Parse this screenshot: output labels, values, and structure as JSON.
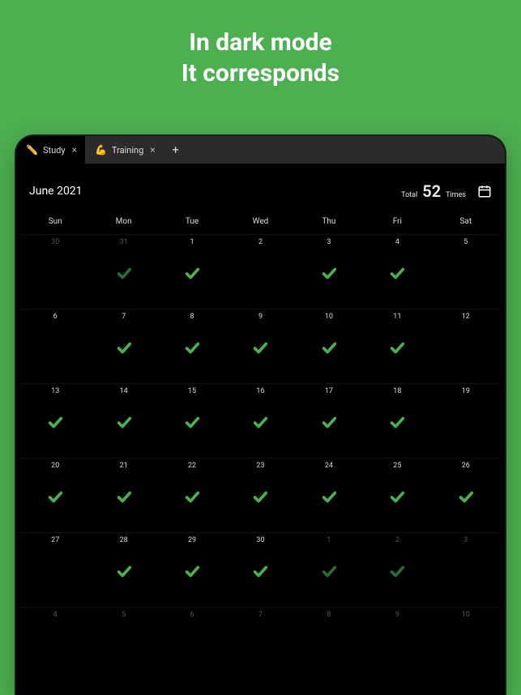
{
  "promo": {
    "line1": "In dark mode",
    "line2": "It corresponds"
  },
  "tabs": [
    {
      "emoji": "✏️",
      "label": "Study",
      "active": true
    },
    {
      "emoji": "💪",
      "label": "Training",
      "active": false
    }
  ],
  "header": {
    "month": "June 2021",
    "total_label": "Total",
    "total_value": "52",
    "total_unit": "Times"
  },
  "dow": [
    "Sun",
    "Mon",
    "Tue",
    "Wed",
    "Thu",
    "Fri",
    "Sat"
  ],
  "cells": [
    {
      "n": "30",
      "other": true,
      "check": false
    },
    {
      "n": "31",
      "other": true,
      "check": true,
      "muted": true
    },
    {
      "n": "1",
      "check": true
    },
    {
      "n": "2",
      "check": false
    },
    {
      "n": "3",
      "check": true
    },
    {
      "n": "4",
      "check": true
    },
    {
      "n": "5",
      "check": false
    },
    {
      "n": "6",
      "check": false
    },
    {
      "n": "7",
      "check": true
    },
    {
      "n": "8",
      "check": true
    },
    {
      "n": "9",
      "check": true
    },
    {
      "n": "10",
      "check": true
    },
    {
      "n": "11",
      "check": true
    },
    {
      "n": "12",
      "check": false
    },
    {
      "n": "13",
      "check": true
    },
    {
      "n": "14",
      "check": true
    },
    {
      "n": "15",
      "check": true
    },
    {
      "n": "16",
      "check": true
    },
    {
      "n": "17",
      "check": true
    },
    {
      "n": "18",
      "check": true
    },
    {
      "n": "19",
      "check": false
    },
    {
      "n": "20",
      "check": true
    },
    {
      "n": "21",
      "check": true
    },
    {
      "n": "22",
      "check": true
    },
    {
      "n": "23",
      "check": true
    },
    {
      "n": "24",
      "check": true
    },
    {
      "n": "25",
      "check": true
    },
    {
      "n": "26",
      "check": true
    },
    {
      "n": "27",
      "check": false
    },
    {
      "n": "28",
      "check": true
    },
    {
      "n": "29",
      "check": true
    },
    {
      "n": "30",
      "check": true
    },
    {
      "n": "1",
      "other": true,
      "check": true,
      "muted": true
    },
    {
      "n": "2",
      "other": true,
      "check": true,
      "muted": true
    },
    {
      "n": "3",
      "other": true,
      "check": false
    },
    {
      "n": "4",
      "other": true,
      "check": false
    },
    {
      "n": "5",
      "other": true,
      "check": false
    },
    {
      "n": "6",
      "other": true,
      "check": false
    },
    {
      "n": "7",
      "other": true,
      "check": false
    },
    {
      "n": "8",
      "other": true,
      "check": false
    },
    {
      "n": "9",
      "other": true,
      "check": false
    },
    {
      "n": "10",
      "other": true,
      "check": false
    }
  ]
}
